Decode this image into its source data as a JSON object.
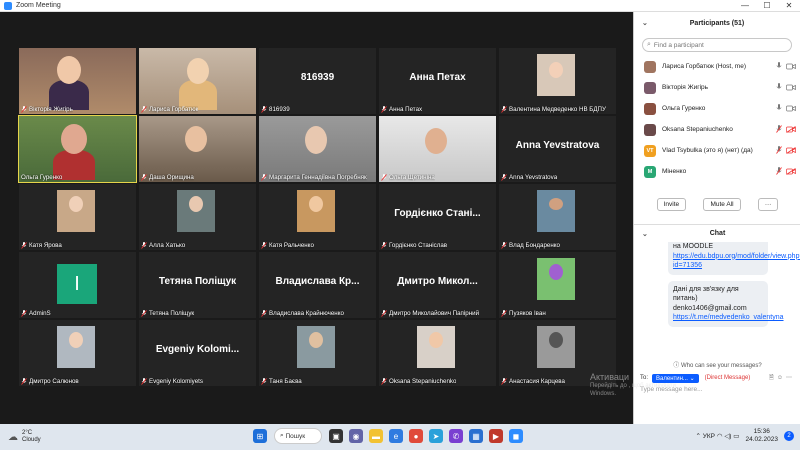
{
  "window": {
    "title": "Zoom Meeting",
    "controls": [
      "—",
      "☐",
      "✕"
    ]
  },
  "gallery": {
    "tiles": [
      {
        "name": "Вікторія Жигірь",
        "big": "",
        "muted": true
      },
      {
        "name": "Лариса Горбатюк",
        "big": "",
        "muted": true
      },
      {
        "name": "816939",
        "big": "816939",
        "muted": true
      },
      {
        "name": "Анна Петах",
        "big": "Анна Петах",
        "muted": true
      },
      {
        "name": "Валентина Медведенко НВ БДПУ",
        "big": "",
        "muted": true
      },
      {
        "name": "Ольга Гуренко",
        "big": "",
        "muted": false
      },
      {
        "name": "Даша Орищина",
        "big": "",
        "muted": true
      },
      {
        "name": "Маргарита Геннадіївна Погребняк",
        "big": "",
        "muted": true
      },
      {
        "name": "Ольга Щетиніна",
        "big": "",
        "muted": true
      },
      {
        "name": "Anna Yevstratova",
        "big": "Anna Yevstratova",
        "muted": true
      },
      {
        "name": "Катя Ярова",
        "big": "",
        "muted": true
      },
      {
        "name": "Алла Хатько",
        "big": "",
        "muted": true
      },
      {
        "name": "Катя Ральченко",
        "big": "",
        "muted": true
      },
      {
        "name": "Гордієнко Станіслав",
        "big": "Гордієнко Стані...",
        "muted": true
      },
      {
        "name": "Влад Бондаренко",
        "big": "",
        "muted": true
      },
      {
        "name": "AdminS",
        "big": "",
        "muted": true
      },
      {
        "name": "Тетяна Поліщук",
        "big": "Тетяна Поліщук",
        "muted": true
      },
      {
        "name": "Владислава Крайнюченко",
        "big": "Владислава Кр...",
        "muted": true
      },
      {
        "name": "Дмитро Миколайович Папірний",
        "big": "Дмитро Микол...",
        "muted": true
      },
      {
        "name": "Пузяков Іван",
        "big": "",
        "muted": true
      },
      {
        "name": "Дмитро Салюнов",
        "big": "",
        "muted": true
      },
      {
        "name": "Evgeniy Kolomiyets",
        "big": "Evgeniy Kolomi...",
        "muted": true
      },
      {
        "name": "Таня Баєва",
        "big": "",
        "muted": true
      },
      {
        "name": "Oksana Stepaniuchenko",
        "big": "",
        "muted": true
      },
      {
        "name": "Анастасия Карцева",
        "big": "",
        "muted": true
      }
    ],
    "admin_initial": "I"
  },
  "participants": {
    "header": "Participants (51)",
    "search_placeholder": "Find a participant",
    "list": [
      {
        "name": "Лариса Горбатюк (Host, me)",
        "initials": "",
        "color": "#a07560",
        "mic_muted": false,
        "cam_off": false
      },
      {
        "name": "Вікторія Жигірь",
        "initials": "",
        "color": "#7a5a6a",
        "mic_muted": false,
        "cam_off": false
      },
      {
        "name": "Ольга Гуренко",
        "initials": "",
        "color": "#8a5040",
        "mic_muted": false,
        "cam_off": false
      },
      {
        "name": "Oksana Stepaniuchenko",
        "initials": "",
        "color": "#6a4a4a",
        "mic_muted": true,
        "cam_off": true
      },
      {
        "name": "Vlad Tsybulka (это я) (нет) (да)",
        "initials": "VT",
        "color": "#f0a020",
        "mic_muted": true,
        "cam_off": true
      },
      {
        "name": "Міненко",
        "initials": "M",
        "color": "#2aa774",
        "mic_muted": true,
        "cam_off": true
      }
    ],
    "invite_label": "Invite",
    "mute_all_label": "Mute All",
    "more_label": "···"
  },
  "chat": {
    "header": "Chat",
    "msg1_text": "на MOODLE",
    "msg1_link": "https://edu.bdpu.org/mod/folder/view.php?id=71356",
    "msg2_text": "Дані для зв'язку для питань)",
    "msg2_email": "denko1406@gmail.com",
    "msg2_link": "https://t.me/medvedenko_valentyna",
    "who_can": "Who can see your messages?",
    "to_label": "To:",
    "recipient": "Валентин...",
    "dm_label": "(Direct Message)",
    "input_placeholder": "Type message here..."
  },
  "watermark": {
    "line1": "Активаци",
    "line2": "Перейдіть до                     , щоб активувати",
    "line3": "Windows."
  },
  "taskbar": {
    "temp": "2°C",
    "weather": "Cloudy",
    "search_label": "Пошук",
    "lang": "УКР",
    "time": "15:36",
    "date": "24.02.2023",
    "notif_count": "2"
  }
}
